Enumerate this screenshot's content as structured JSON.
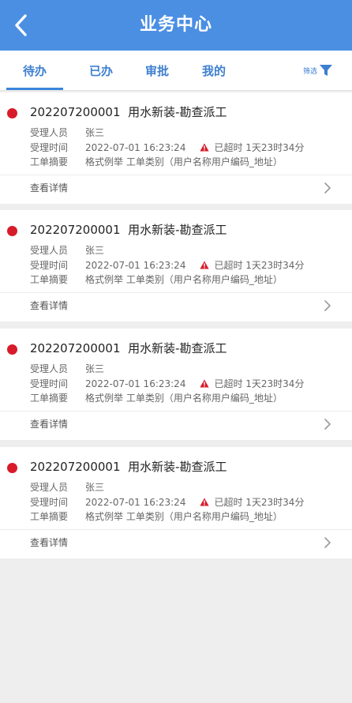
{
  "header": {
    "title": "业务中心",
    "back_icon": "chevron-left-icon"
  },
  "tabs": [
    {
      "label": "待办",
      "active": true
    },
    {
      "label": "已办",
      "active": false
    },
    {
      "label": "审批",
      "active": false
    },
    {
      "label": "我的",
      "active": false
    }
  ],
  "filter": {
    "label": "筛选",
    "icon": "filter-icon"
  },
  "colors": {
    "header_bg": "#4b8fe3",
    "tab_text": "#3e7fd0",
    "status_dot": "#d81b2a",
    "warning": "#d81b2a"
  },
  "cards": [
    {
      "number": "202207200001",
      "title": "用水新装-勘查派工",
      "handler_label": "受理人员",
      "handler": "张三",
      "time_label": "受理时间",
      "time": "2022-07-01 16:23:24",
      "overdue": "已超时 1天23时34分",
      "summary_label": "工单摘要",
      "summary": "格式例举  工单类别（用户名称用户编码_地址）",
      "detail_label": "查看详情"
    },
    {
      "number": "202207200001",
      "title": "用水新装-勘查派工",
      "handler_label": "受理人员",
      "handler": "张三",
      "time_label": "受理时间",
      "time": "2022-07-01 16:23:24",
      "overdue": "已超时 1天23时34分",
      "summary_label": "工单摘要",
      "summary": "格式例举  工单类别（用户名称用户编码_地址）",
      "detail_label": "查看详情"
    },
    {
      "number": "202207200001",
      "title": "用水新装-勘查派工",
      "handler_label": "受理人员",
      "handler": "张三",
      "time_label": "受理时间",
      "time": "2022-07-01 16:23:24",
      "overdue": "已超时 1天23时34分",
      "summary_label": "工单摘要",
      "summary": "格式例举  工单类别（用户名称用户编码_地址）",
      "detail_label": "查看详情"
    },
    {
      "number": "202207200001",
      "title": "用水新装-勘查派工",
      "handler_label": "受理人员",
      "handler": "张三",
      "time_label": "受理时间",
      "time": "2022-07-01 16:23:24",
      "overdue": "已超时 1天23时34分",
      "summary_label": "工单摘要",
      "summary": "格式例举  工单类别（用户名称用户编码_地址）",
      "detail_label": "查看详情"
    }
  ]
}
